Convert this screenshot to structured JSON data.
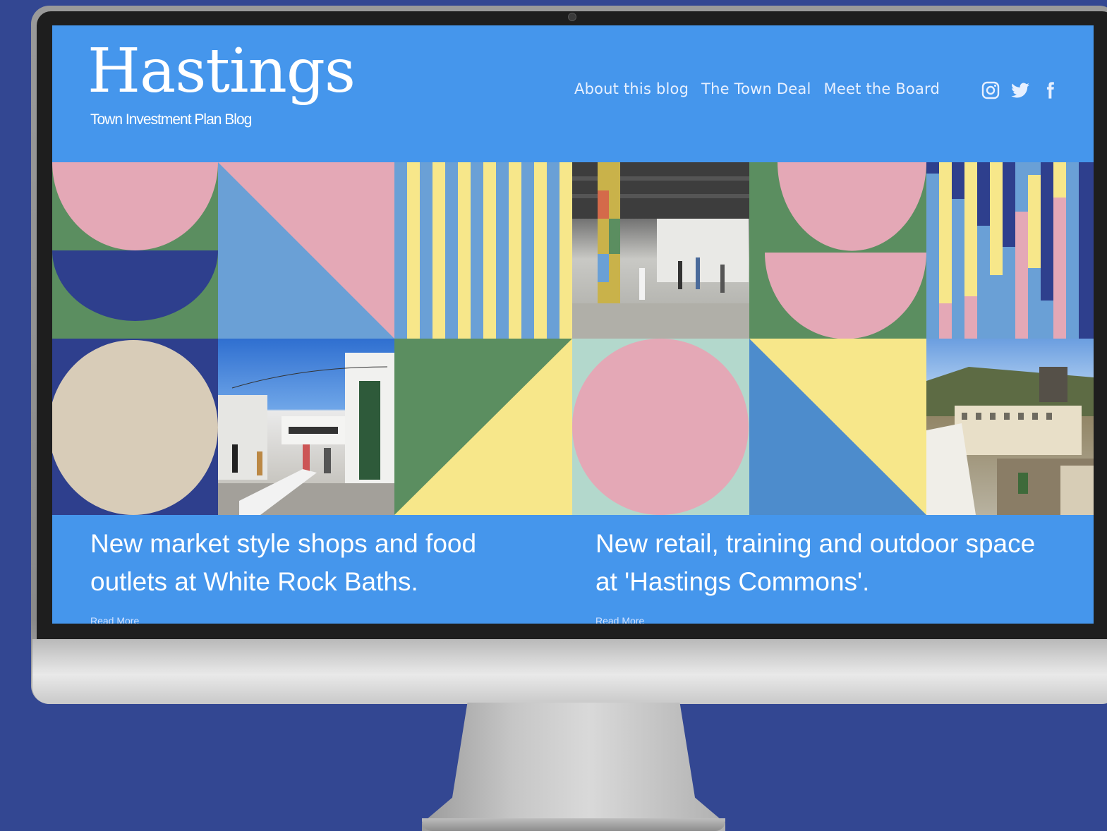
{
  "site": {
    "title": "Hastings",
    "subtitle": "Town Investment Plan Blog"
  },
  "nav": {
    "items": [
      "About this blog",
      "The Town Deal",
      "Meet the Board"
    ]
  },
  "social": {
    "icons": [
      "instagram-icon",
      "twitter-icon",
      "facebook-icon"
    ]
  },
  "posts": [
    {
      "title": "New market style shops and food outlets at White Rock Baths.",
      "read_more": "Read More"
    },
    {
      "title": "New retail, training and outdoor space at 'Hastings Commons'.",
      "read_more": "Read More"
    }
  ],
  "colors": {
    "background": "#334792",
    "screen_blue": "#4596ec",
    "pink": "#e4a8b6",
    "green": "#5b8e60",
    "navy": "#2e3f8d",
    "light_blue": "#6aa0d6",
    "yellow": "#f7e78a",
    "beige": "#d8ccb8",
    "mint": "#b3d8cc"
  }
}
